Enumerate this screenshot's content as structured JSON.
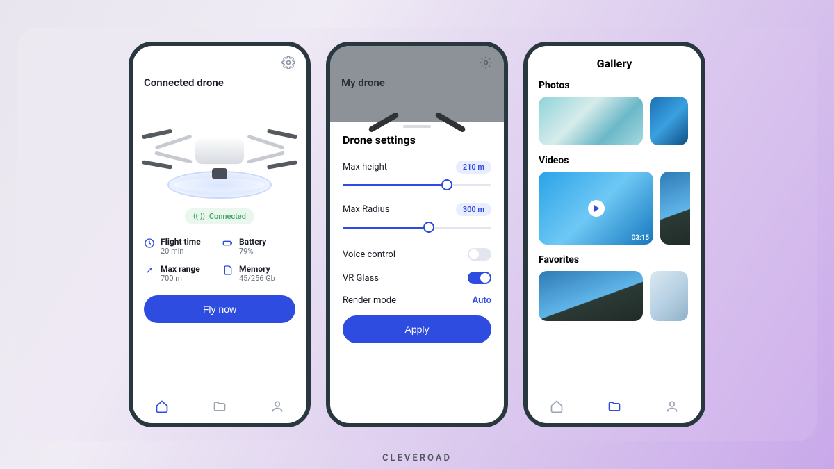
{
  "brand": "CLEVEROAD",
  "phone1": {
    "title": "Connected drone",
    "status": "Connected",
    "stats": {
      "flight_time": {
        "label": "Flight time",
        "value": "20 min"
      },
      "battery": {
        "label": "Battery",
        "value": "79%"
      },
      "max_range": {
        "label": "Max range",
        "value": "700 m"
      },
      "memory": {
        "label": "Memory",
        "value": "45/256 Gb"
      }
    },
    "cta": "Fly now"
  },
  "phone2": {
    "title": "My drone",
    "sheet_title": "Drone settings",
    "max_height": {
      "label": "Max height",
      "value": "210 m",
      "percent": 70
    },
    "max_radius": {
      "label": "Max Radius",
      "value": "300 m",
      "percent": 58
    },
    "voice": {
      "label": "Voice control",
      "on": false
    },
    "vr": {
      "label": "VR Glass",
      "on": true
    },
    "render": {
      "label": "Render mode",
      "value": "Auto"
    },
    "cta": "Apply"
  },
  "phone3": {
    "title": "Gallery",
    "sections": {
      "photos": {
        "label": "Photos"
      },
      "videos": {
        "label": "Videos",
        "items": [
          {
            "duration": "03:15"
          }
        ]
      },
      "favorites": {
        "label": "Favorites"
      }
    }
  },
  "icons": {
    "gear": "gear-icon",
    "home": "home-icon",
    "folder": "folder-icon",
    "profile": "profile-icon",
    "clock": "clock-icon",
    "battery": "battery-icon",
    "range": "expand-icon",
    "memory": "sd-card-icon",
    "signal": "signal-icon"
  },
  "colors": {
    "accent": "#2e4ce0",
    "success": "#3aa660"
  }
}
